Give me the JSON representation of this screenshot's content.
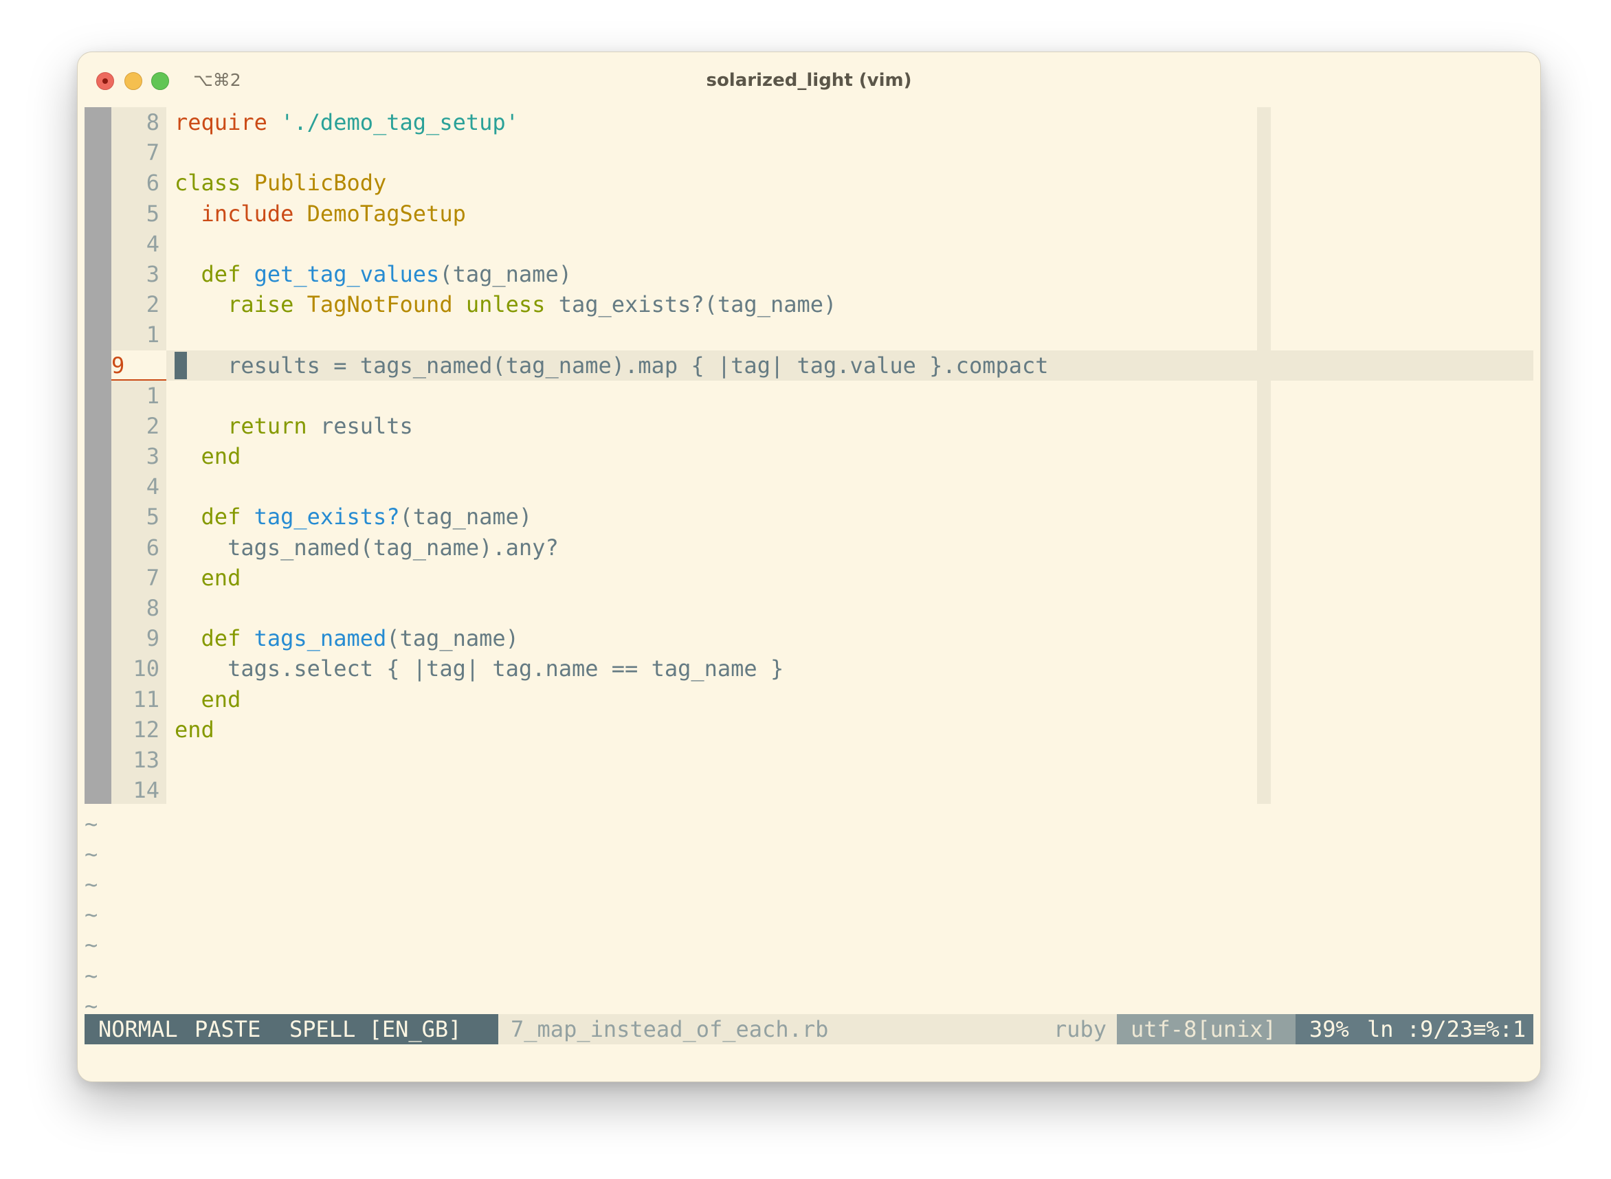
{
  "window": {
    "shortcut": "⌥⌘2",
    "title": "solarized_light (vim)"
  },
  "editor": {
    "lines": [
      {
        "num": "8",
        "tokens": [
          {
            "t": "require ",
            "c": "kw-red"
          },
          {
            "t": "'./demo_tag_setup'",
            "c": "str"
          }
        ]
      },
      {
        "num": "7",
        "tokens": []
      },
      {
        "num": "6",
        "tokens": [
          {
            "t": "class ",
            "c": "kw-green"
          },
          {
            "t": "PublicBody",
            "c": "kw-yellow"
          }
        ]
      },
      {
        "num": "5",
        "tokens": [
          {
            "t": "  ",
            "c": "txt"
          },
          {
            "t": "include ",
            "c": "kw-red"
          },
          {
            "t": "DemoTagSetup",
            "c": "kw-yellow"
          }
        ]
      },
      {
        "num": "4",
        "tokens": []
      },
      {
        "num": "3",
        "tokens": [
          {
            "t": "  ",
            "c": "txt"
          },
          {
            "t": "def ",
            "c": "kw-green"
          },
          {
            "t": "get_tag_values",
            "c": "fn"
          },
          {
            "t": "(tag_name)",
            "c": "txt"
          }
        ]
      },
      {
        "num": "2",
        "tokens": [
          {
            "t": "    ",
            "c": "txt"
          },
          {
            "t": "raise ",
            "c": "kw-green"
          },
          {
            "t": "TagNotFound ",
            "c": "kw-yellow"
          },
          {
            "t": "unless ",
            "c": "kw-green"
          },
          {
            "t": "tag_exists?(tag_name)",
            "c": "txt"
          }
        ]
      },
      {
        "num": "1",
        "tokens": []
      },
      {
        "num": "9",
        "current": true,
        "tokens": [
          {
            "t": "    results = tags_named(tag_name).map { |tag| tag.value }.compact",
            "c": "txt"
          }
        ]
      },
      {
        "num": "1",
        "tokens": []
      },
      {
        "num": "2",
        "tokens": [
          {
            "t": "    ",
            "c": "txt"
          },
          {
            "t": "return ",
            "c": "kw-green"
          },
          {
            "t": "results",
            "c": "txt"
          }
        ]
      },
      {
        "num": "3",
        "tokens": [
          {
            "t": "  ",
            "c": "txt"
          },
          {
            "t": "end",
            "c": "kw-green"
          }
        ]
      },
      {
        "num": "4",
        "tokens": []
      },
      {
        "num": "5",
        "tokens": [
          {
            "t": "  ",
            "c": "txt"
          },
          {
            "t": "def ",
            "c": "kw-green"
          },
          {
            "t": "tag_exists?",
            "c": "fn"
          },
          {
            "t": "(tag_name)",
            "c": "txt"
          }
        ]
      },
      {
        "num": "6",
        "tokens": [
          {
            "t": "    tags_named(tag_name).any?",
            "c": "txt"
          }
        ]
      },
      {
        "num": "7",
        "tokens": [
          {
            "t": "  ",
            "c": "txt"
          },
          {
            "t": "end",
            "c": "kw-green"
          }
        ]
      },
      {
        "num": "8",
        "tokens": []
      },
      {
        "num": "9",
        "tokens": [
          {
            "t": "  ",
            "c": "txt"
          },
          {
            "t": "def ",
            "c": "kw-green"
          },
          {
            "t": "tags_named",
            "c": "fn"
          },
          {
            "t": "(tag_name)",
            "c": "txt"
          }
        ]
      },
      {
        "num": "10",
        "tokens": [
          {
            "t": "    tags.select { |tag| tag.name == tag_name }",
            "c": "txt"
          }
        ]
      },
      {
        "num": "11",
        "tokens": [
          {
            "t": "  ",
            "c": "txt"
          },
          {
            "t": "end",
            "c": "kw-green"
          }
        ]
      },
      {
        "num": "12",
        "tokens": [
          {
            "t": "end",
            "c": "kw-green"
          }
        ]
      },
      {
        "num": "13",
        "tokens": []
      },
      {
        "num": "14",
        "tokens": []
      }
    ],
    "tilde_char": "~",
    "tilde_count": 7
  },
  "statusline": {
    "mode": "NORMAL",
    "paste": "PASTE",
    "spell": "SPELL [EN_GB]",
    "filename": "7_map_instead_of_each.rb",
    "filetype": "ruby",
    "encoding": "utf-8[unix]",
    "percent": "39%",
    "position": "ln :9/23≡%:1"
  },
  "colors": {
    "background": "#fdf6e3",
    "gutter": "#eee8d5",
    "sign_column": "#a8a8a8",
    "red": "#cb4b16",
    "green": "#859900",
    "yellow": "#b58900",
    "cyan": "#2aa198",
    "blue": "#268bd2",
    "text": "#657b83"
  }
}
